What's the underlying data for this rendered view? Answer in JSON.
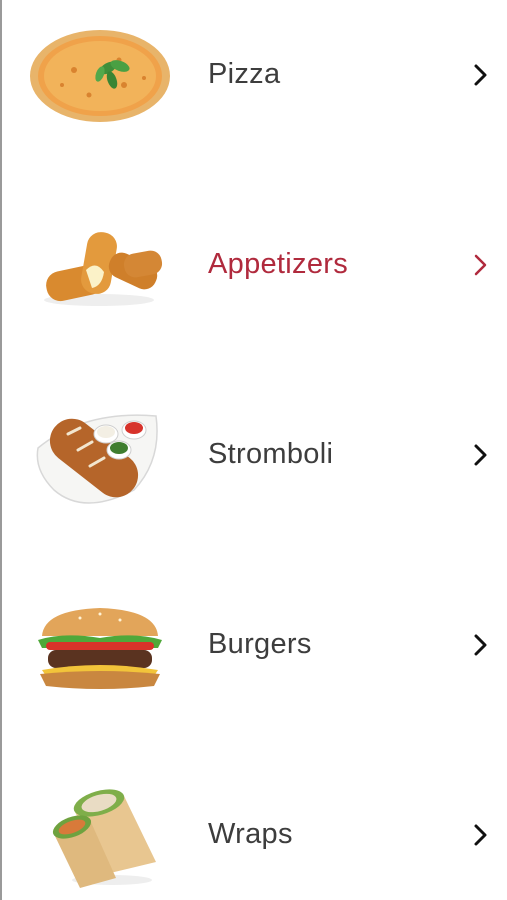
{
  "menu": {
    "items": [
      {
        "label": "Pizza",
        "icon": "pizza-icon",
        "active": false
      },
      {
        "label": "Appetizers",
        "icon": "mozzarella-sticks-icon",
        "active": true
      },
      {
        "label": "Stromboli",
        "icon": "stromboli-icon",
        "active": false
      },
      {
        "label": "Burgers",
        "icon": "burger-icon",
        "active": false
      },
      {
        "label": "Wraps",
        "icon": "wrap-icon",
        "active": false
      }
    ],
    "chevron_icon": "chevron-right-icon"
  },
  "colors": {
    "default_text": "#3d3d3d",
    "active_text": "#b02a3d",
    "default_chevron": "#111111",
    "active_chevron": "#b02a3d",
    "background": "#ffffff"
  }
}
